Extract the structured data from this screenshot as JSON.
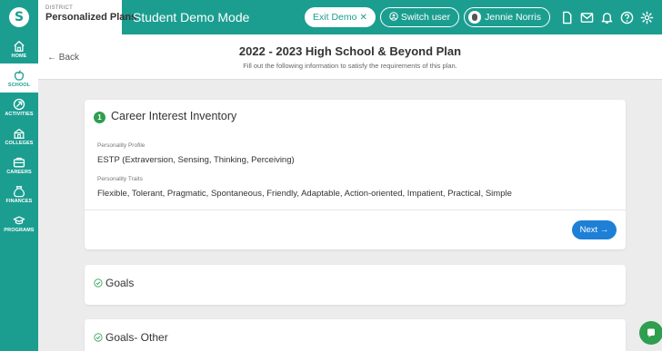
{
  "topbar": {
    "logo_glyph": "S",
    "district_label": "DISTRICT",
    "district_name": "Personalized Plans",
    "mode_title": "Student Demo Mode",
    "exit_demo_label": "Exit Demo",
    "exit_demo_icon": "close-icon",
    "switch_user_label": "Switch user",
    "user_name": "Jennie Norris",
    "icons": [
      "document-icon",
      "mail-icon",
      "bell-icon",
      "help-icon",
      "settings-icon"
    ]
  },
  "sidebar": {
    "items": [
      {
        "label": "HOME",
        "icon": "home-icon",
        "active": false
      },
      {
        "label": "SCHOOL",
        "icon": "apple-icon",
        "active": true
      },
      {
        "label": "ACTIVITIES",
        "icon": "activities-icon",
        "active": false
      },
      {
        "label": "COLLEGES",
        "icon": "college-icon",
        "active": false
      },
      {
        "label": "CAREERS",
        "icon": "briefcase-icon",
        "active": false
      },
      {
        "label": "FINANCES",
        "icon": "money-bag-icon",
        "active": false
      },
      {
        "label": "PROGRAMS",
        "icon": "programs-icon",
        "active": false
      }
    ]
  },
  "header": {
    "back_label": "← Back",
    "title": "2022 - 2023 High School & Beyond Plan",
    "subtitle": "Fill out the following information to satisfy the requirements of this plan."
  },
  "main": {
    "sections": [
      {
        "step": "1",
        "title": "Career Interest Inventory",
        "expanded": true,
        "fields": [
          {
            "label": "Personality Profile",
            "value": "ESTP (Extraversion, Sensing, Thinking, Perceiving)"
          },
          {
            "label": "Personality Traits",
            "value": "Flexible, Tolerant, Pragmatic, Spontaneous, Friendly, Adaptable, Action-oriented, Impatient, Practical, Simple"
          }
        ],
        "next_label": "Next →"
      },
      {
        "title": "Goals",
        "expanded": false
      },
      {
        "title": "Goals- Other",
        "expanded": false
      }
    ]
  },
  "colors": {
    "brand": "#1b9e90",
    "step_badge": "#2f9e4f",
    "next_button": "#1e7fd6"
  }
}
